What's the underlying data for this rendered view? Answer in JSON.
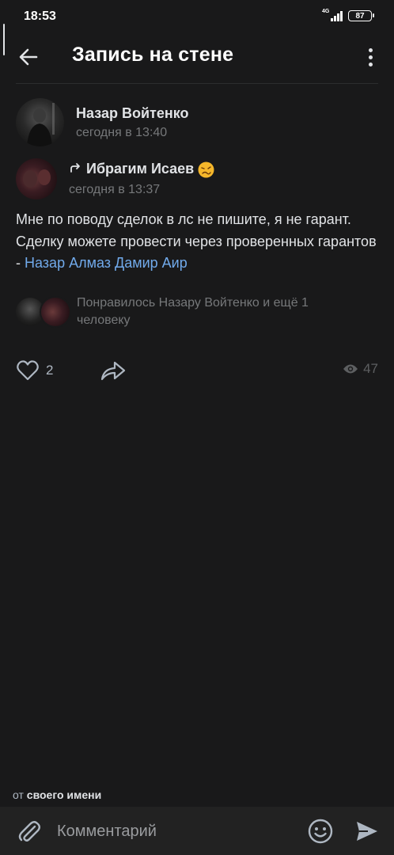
{
  "status_bar": {
    "time": "18:53",
    "network": "4G",
    "battery": "87"
  },
  "header": {
    "title": "Запись на стене",
    "back_icon": "arrow-left-icon",
    "menu_icon": "more-vertical-icon"
  },
  "post": {
    "author": {
      "name": "Назар Войтенко",
      "time": "сегодня в 13:40"
    },
    "repost": {
      "name": "Ибрагим Исаев",
      "time": "сегодня в 13:37",
      "emoji": "🥴"
    },
    "text_main": "Мне по поводу сделок в лс не пишите, я не гарант. Сделку можете провести через проверенных гарантов - ",
    "text_link": "Назар Алмаз Дамир Аир",
    "likes_summary": "Понравилось Назару Войтенко и ещё 1 человеку",
    "like_count": "2",
    "views_count": "47"
  },
  "composer": {
    "from_prefix": "от",
    "from_value": "своего имени",
    "placeholder": "Комментарий"
  },
  "colors": {
    "background": "#19191a",
    "text": "#e1e3e6",
    "secondary": "#76787a",
    "link": "#71aaeb",
    "composer_bg": "#222222"
  }
}
